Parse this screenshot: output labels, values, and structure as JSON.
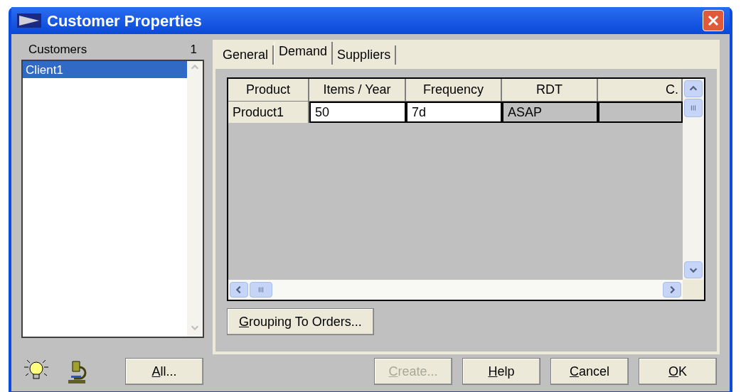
{
  "window": {
    "title": "Customer Properties"
  },
  "customers": {
    "label": "Customers",
    "count": "1",
    "items": [
      {
        "name": "Client1",
        "selected": true
      }
    ]
  },
  "tabs": [
    {
      "label": "General",
      "selected": false
    },
    {
      "label": "Demand",
      "selected": true
    },
    {
      "label": "Suppliers",
      "selected": false
    }
  ],
  "table": {
    "columns": [
      "Product",
      "Items / Year",
      "Frequency",
      "RDT",
      "C."
    ],
    "rows": [
      [
        {
          "text": "Product1",
          "kind": "rowheader"
        },
        {
          "text": "50",
          "kind": "input"
        },
        {
          "text": "7d",
          "kind": "input"
        },
        {
          "text": "ASAP",
          "kind": "readonly"
        },
        {
          "text": "",
          "kind": "readonly"
        }
      ]
    ]
  },
  "grouping_button": {
    "accel": "G",
    "rest": "rouping To Orders...",
    "disabled": false
  },
  "all_button": {
    "accel": "A",
    "rest": "ll...",
    "disabled": false
  },
  "buttons": [
    {
      "accel": "C",
      "rest": "reate...",
      "disabled": true
    },
    {
      "accel": "H",
      "rest": "elp",
      "disabled": false
    },
    {
      "accel": "C",
      "rest": "ancel",
      "disabled": false
    },
    {
      "accel": "O",
      "rest": "K",
      "disabled": false
    }
  ]
}
